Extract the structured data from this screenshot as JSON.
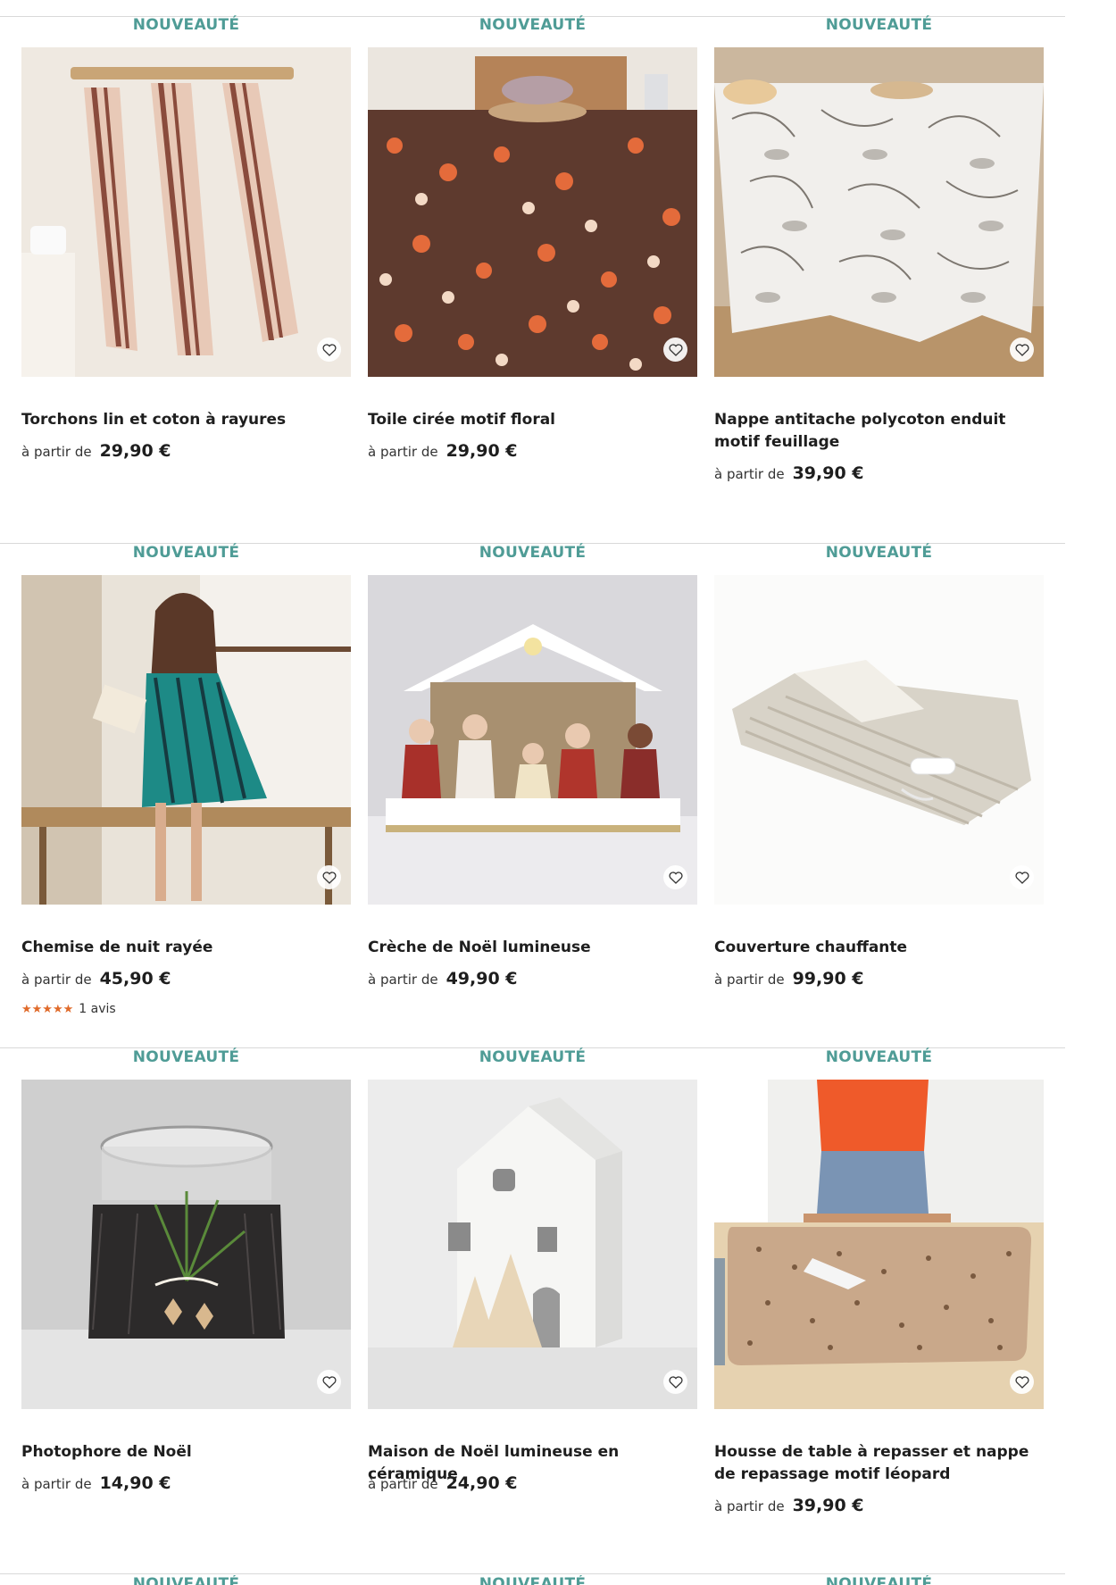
{
  "products": [
    {
      "badge": "NOUVEAUTÉ",
      "title": "Torchons lin et coton à rayures",
      "from": "à partir de",
      "price": "29,90 €"
    },
    {
      "badge": "NOUVEAUTÉ",
      "title": "Toile cirée motif floral",
      "from": "à partir de",
      "price": "29,90 €"
    },
    {
      "badge": "NOUVEAUTÉ",
      "title": "Nappe antitache polycoton enduit motif feuillage",
      "from": "à partir de",
      "price": "39,90 €"
    },
    {
      "badge": "NOUVEAUTÉ",
      "title": "Chemise de nuit rayée",
      "from": "à partir de",
      "price": "45,90 €",
      "stars": "★★★★★",
      "stars_value": 5,
      "reviews": "1 avis"
    },
    {
      "badge": "NOUVEAUTÉ",
      "title": "Crèche de Noël lumineuse",
      "from": "à partir de",
      "price": "49,90 €"
    },
    {
      "badge": "NOUVEAUTÉ",
      "title": "Couverture chauffante",
      "from": "à partir de",
      "price": "99,90 €"
    },
    {
      "badge": "NOUVEAUTÉ",
      "title": "Photophore de Noël",
      "from": "à partir de",
      "price": "14,90 €"
    },
    {
      "badge": "NOUVEAUTÉ",
      "title": "Maison de Noël lumineuse en céramique",
      "from": "à partir de",
      "price": "24,90 €"
    },
    {
      "badge": "NOUVEAUTÉ",
      "title": "Housse de table à repasser et nappe de repassage motif léopard",
      "from": "à partir de",
      "price": "39,90 €"
    }
  ],
  "next_row_badges": [
    "NOUVEAUTÉ",
    "NOUVEAUTÉ",
    "NOUVEAUTÉ"
  ],
  "colors": {
    "badge": "#4f9c96",
    "stars": "#e06a2a",
    "separator": "#d9d9d9"
  }
}
